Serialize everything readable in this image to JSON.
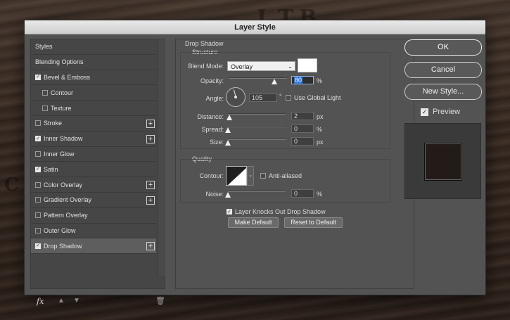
{
  "window": {
    "title": "Layer Style"
  },
  "background": {
    "letters": [
      "I",
      "T",
      "B",
      "C"
    ]
  },
  "styles_list": {
    "items": [
      {
        "label": "Styles",
        "checkbox": false,
        "checked": false,
        "sub": false,
        "plus": false,
        "selected": false
      },
      {
        "label": "Blending Options",
        "checkbox": false,
        "checked": false,
        "sub": false,
        "plus": false,
        "selected": false
      },
      {
        "label": "Bevel & Emboss",
        "checkbox": true,
        "checked": true,
        "sub": false,
        "plus": false,
        "selected": false
      },
      {
        "label": "Contour",
        "checkbox": true,
        "checked": false,
        "sub": true,
        "plus": false,
        "selected": false
      },
      {
        "label": "Texture",
        "checkbox": true,
        "checked": false,
        "sub": true,
        "plus": false,
        "selected": false
      },
      {
        "label": "Stroke",
        "checkbox": true,
        "checked": false,
        "sub": false,
        "plus": true,
        "selected": false
      },
      {
        "label": "Inner Shadow",
        "checkbox": true,
        "checked": true,
        "sub": false,
        "plus": true,
        "selected": false
      },
      {
        "label": "Inner Glow",
        "checkbox": true,
        "checked": false,
        "sub": false,
        "plus": false,
        "selected": false
      },
      {
        "label": "Satin",
        "checkbox": true,
        "checked": true,
        "sub": false,
        "plus": false,
        "selected": false
      },
      {
        "label": "Color Overlay",
        "checkbox": true,
        "checked": false,
        "sub": false,
        "plus": true,
        "selected": false
      },
      {
        "label": "Gradient Overlay",
        "checkbox": true,
        "checked": false,
        "sub": false,
        "plus": true,
        "selected": false
      },
      {
        "label": "Pattern Overlay",
        "checkbox": true,
        "checked": false,
        "sub": false,
        "plus": false,
        "selected": false
      },
      {
        "label": "Outer Glow",
        "checkbox": true,
        "checked": false,
        "sub": false,
        "plus": false,
        "selected": false
      },
      {
        "label": "Drop Shadow",
        "checkbox": true,
        "checked": true,
        "sub": false,
        "plus": true,
        "selected": true
      }
    ],
    "footer": {
      "fx_label": "fx",
      "up_icon": "arrow-up-icon",
      "down_icon": "arrow-down-icon",
      "trash_icon": "trash-icon"
    }
  },
  "drop_shadow": {
    "section_title": "Drop Shadow",
    "structure": {
      "title": "Structure",
      "blend_mode_label": "Blend Mode:",
      "blend_mode_value": "Overlay",
      "shadow_color": "#ffffff",
      "opacity_label": "Opacity:",
      "opacity_value": "80",
      "opacity_unit": "%",
      "angle_label": "Angle:",
      "angle_value": "105",
      "angle_unit": "°",
      "use_global_light_label": "Use Global Light",
      "use_global_light_checked": false,
      "distance_label": "Distance:",
      "distance_value": "2",
      "distance_unit": "px",
      "spread_label": "Spread:",
      "spread_value": "0",
      "spread_unit": "%",
      "size_label": "Size:",
      "size_value": "0",
      "size_unit": "px"
    },
    "quality": {
      "title": "Quality",
      "contour_label": "Contour:",
      "anti_aliased_label": "Anti-aliased",
      "anti_aliased_checked": false,
      "noise_label": "Noise:",
      "noise_value": "0",
      "noise_unit": "%"
    },
    "knocks_out_label": "Layer Knocks Out Drop Shadow",
    "knocks_out_checked": true,
    "make_default_label": "Make Default",
    "reset_default_label": "Reset to Default"
  },
  "buttons": {
    "ok": "OK",
    "cancel": "Cancel",
    "new_style": "New Style..."
  },
  "preview": {
    "label": "Preview",
    "checked": true,
    "swatch_color": "#221b17"
  }
}
